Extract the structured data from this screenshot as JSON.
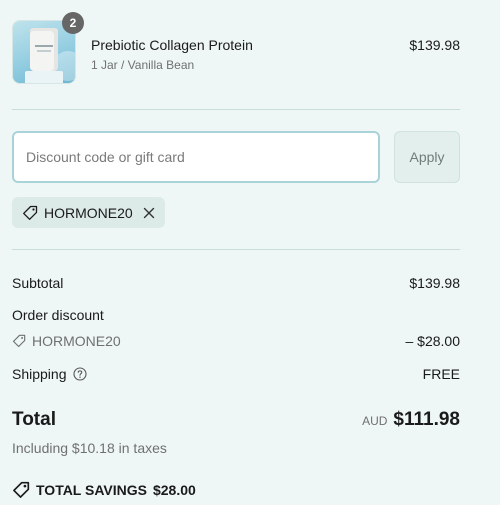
{
  "product": {
    "quantity": "2",
    "name": "Prebiotic Collagen Protein",
    "variant": "1 Jar / Vanilla Bean",
    "price": "$139.98"
  },
  "discount": {
    "placeholder": "Discount code or gift card",
    "value": "",
    "apply_label": "Apply",
    "applied_code": "HORMONE20"
  },
  "summary": {
    "subtotal_label": "Subtotal",
    "subtotal_value": "$139.98",
    "order_discount_label": "Order discount",
    "discount_code": "HORMONE20",
    "discount_value": "– $28.00",
    "shipping_label": "Shipping",
    "shipping_value": "FREE",
    "total_label": "Total",
    "currency": "AUD",
    "total_value": "$111.98",
    "tax_note": "Including $10.18 in taxes",
    "savings_label": "TOTAL SAVINGS",
    "savings_value": "$28.00"
  },
  "colors": {
    "background": "#eef7f6",
    "accent_border": "#a9d3d8",
    "chip_bg": "#dcebe8",
    "badge_bg": "#666666"
  },
  "icons": {
    "tag": "tag-icon",
    "remove": "close-icon",
    "help": "question-circle-icon"
  }
}
